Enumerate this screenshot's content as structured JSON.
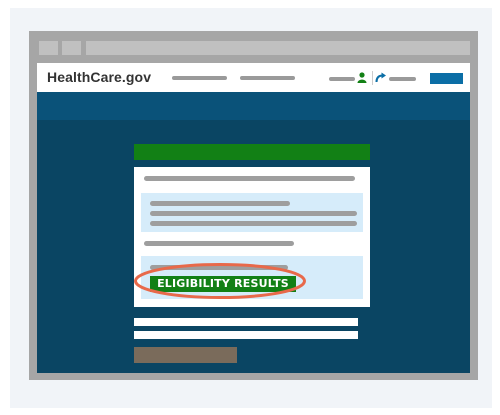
{
  "site": {
    "logo_text": "HealthCare.gov"
  },
  "eligibility": {
    "badge_label": "ELIGIBILITY RESULTS"
  },
  "icons": {
    "user": "user-icon",
    "share": "share-arrow-icon"
  },
  "colors": {
    "site_background": "#0a4563",
    "banner_green": "#128015",
    "header_button_blue": "#0b6ea6",
    "info_box_blue": "#d6ecfa",
    "submit_brown": "#7a6b5b",
    "highlight_orange": "#e8694a"
  }
}
